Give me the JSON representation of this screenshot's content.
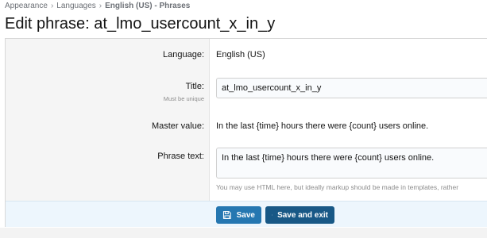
{
  "breadcrumb": {
    "items": [
      "Appearance",
      "Languages",
      "English (US) - Phrases"
    ],
    "separator": "›"
  },
  "page": {
    "title": "Edit phrase: at_lmo_usercount_x_in_y"
  },
  "form": {
    "language": {
      "label": "Language:",
      "value": "English (US)"
    },
    "title": {
      "label": "Title:",
      "hint": "Must be unique",
      "value": "at_lmo_usercount_x_in_y"
    },
    "master_value": {
      "label": "Master value:",
      "value": "In the last {time} hours there were {count} users online."
    },
    "phrase_text": {
      "label": "Phrase text:",
      "value": "In the last {time} hours there were {count} users online.",
      "explain": "You may use HTML here, but ideally markup should be made in templates, rather"
    }
  },
  "actions": {
    "save_label": "Save",
    "save_exit_label": "Save and exit"
  },
  "colors": {
    "primary_button": "#2577b1",
    "secondary_button": "#185886",
    "submit_row_bg": "#edf6fd",
    "label_col_bg": "#f5f5f5"
  },
  "icons": {
    "save": "save-icon",
    "save_exit": "save-icon"
  }
}
